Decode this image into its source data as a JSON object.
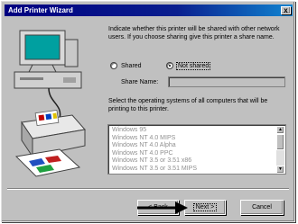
{
  "window": {
    "title": "Add Printer Wizard",
    "close_glyph": "x"
  },
  "instructions": "Indicate whether this printer will be shared with other network users. If you choose sharing give this printer a share name.",
  "sharing": {
    "shared_label": "Shared",
    "not_shared_label": "Not shared",
    "selected": "Not shared",
    "share_name_label": "Share Name:",
    "share_name_value": ""
  },
  "os_prompt": "Select the operating systems of all computers that will be printing to this printer.",
  "os_list": [
    "Windows 95",
    "Windows NT 4.0 MIPS",
    "Windows NT 4.0 Alpha",
    "Windows NT 4.0 PPC",
    "Windows NT 3.5 or 3.51 x86",
    "Windows NT 3.5 or 3.51 MIPS"
  ],
  "buttons": {
    "back": "< Back",
    "next": "Next >",
    "cancel": "Cancel"
  },
  "colors": {
    "title_bar": "#000080",
    "dialog_face": "#c0c0c0"
  }
}
